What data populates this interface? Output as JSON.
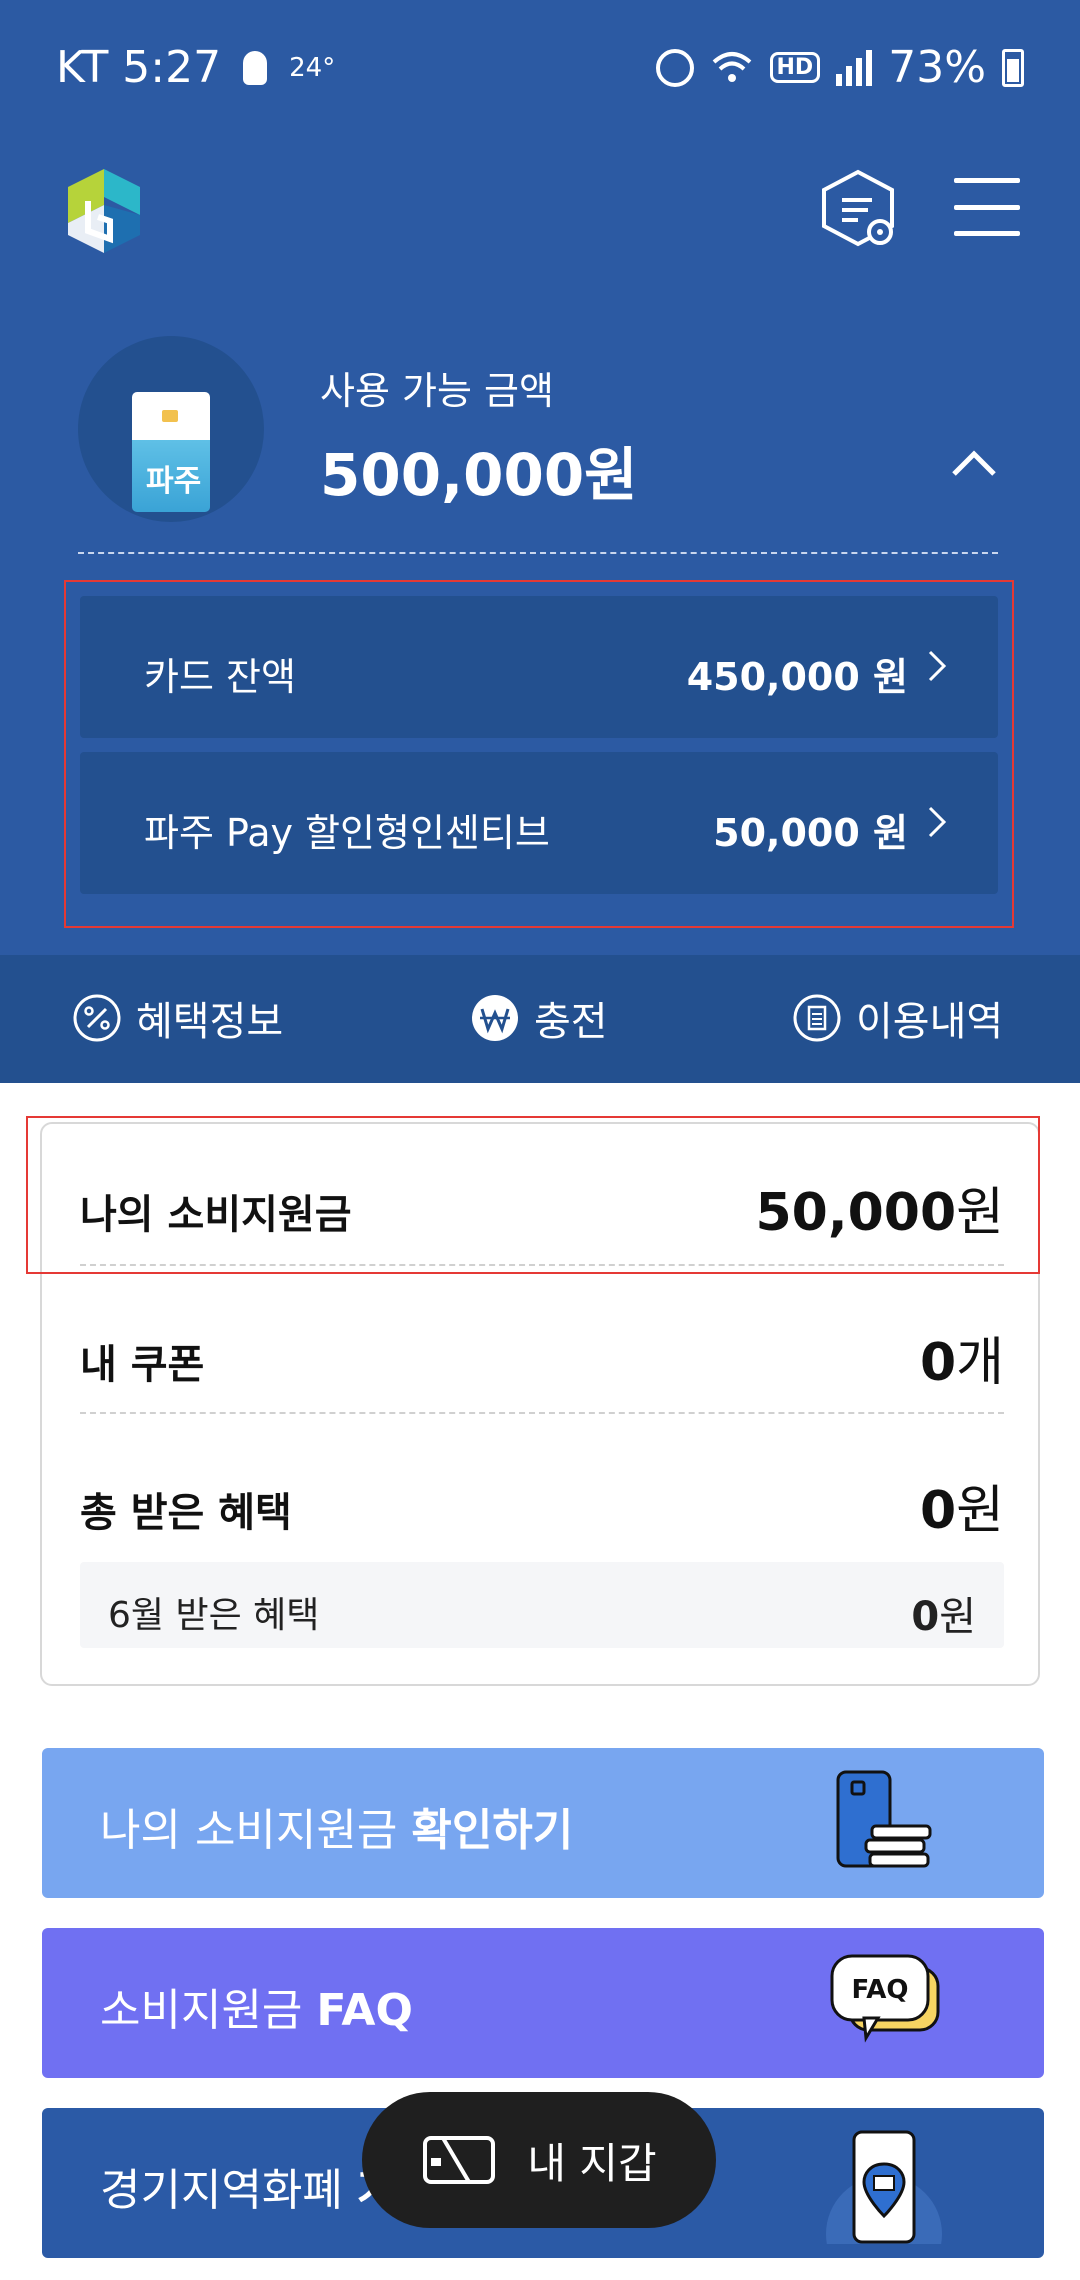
{
  "status_bar": {
    "carrier_time": "KT 5:27",
    "temperature": "24°",
    "battery": "73%"
  },
  "summary": {
    "available_label": "사용 가능 금액",
    "available_amount": "500,000원"
  },
  "balances": [
    {
      "label": "카드 잔액",
      "value": "450,000 원"
    },
    {
      "label": "파주 Pay 할인형인센티브",
      "value": "50,000 원"
    }
  ],
  "menu": [
    {
      "label": "혜택정보",
      "icon": "percent-icon"
    },
    {
      "label": "충전",
      "icon": "won-icon"
    },
    {
      "label": "이용내역",
      "icon": "history-icon"
    }
  ],
  "stats": {
    "subsidy_label": "나의 소비지원금",
    "subsidy_value": "50,000",
    "subsidy_unit": "원",
    "coupon_label": "내 쿠폰",
    "coupon_value": "0",
    "coupon_unit": "개",
    "total_benefit_label": "총 받은 혜택",
    "total_benefit_value": "0",
    "total_benefit_unit": "원",
    "month_benefit_label": "6월 받은 혜택",
    "month_benefit_value": "0",
    "month_benefit_unit": "원"
  },
  "banners": [
    {
      "text_normal": "나의 소비지원금 ",
      "text_bold": "확인하기"
    },
    {
      "text_normal": "소비지원금 ",
      "text_bold": "FAQ"
    },
    {
      "text_normal": "경기지역화폐 ",
      "text_bold": "가"
    }
  ],
  "wallet_button": {
    "label": "내 지갑"
  },
  "colors": {
    "primary_blue": "#2c5aa3",
    "dark_blue": "#23508f",
    "banner_light_blue": "#78a6f0",
    "banner_purple": "#7070f2",
    "highlight_red": "#e53935"
  }
}
